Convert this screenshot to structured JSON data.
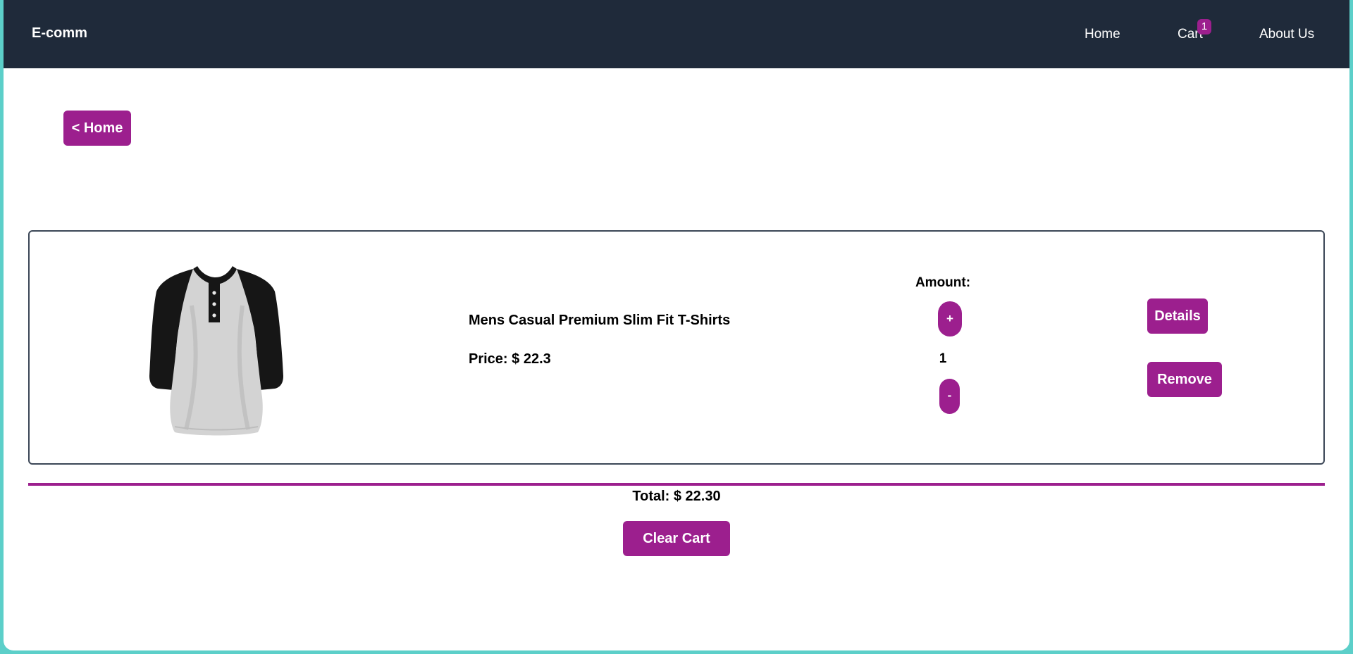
{
  "navbar": {
    "brand": "E-comm",
    "links": {
      "home": "Home",
      "cart": "Cart",
      "about": "About Us"
    },
    "cart_count": "1"
  },
  "page": {
    "back_button": "< Home"
  },
  "cart": {
    "items": [
      {
        "name": "Mens Casual Premium Slim Fit T-Shirts",
        "price_text": "Price: $ 22.3",
        "amount_label": "Amount:",
        "plus_label": "+",
        "quantity": "1",
        "minus_label": "-",
        "details_label": "Details",
        "remove_label": "Remove",
        "image_icon": "henley-raglan-shirt-image"
      }
    ],
    "total_text": "Total: $ 22.30",
    "clear_label": "Clear Cart"
  },
  "colors": {
    "navbar_bg": "#1f2a3a",
    "accent": "#9c1f8e",
    "page_bg": "#ffffff",
    "outer_border": "#5ccfc9"
  }
}
